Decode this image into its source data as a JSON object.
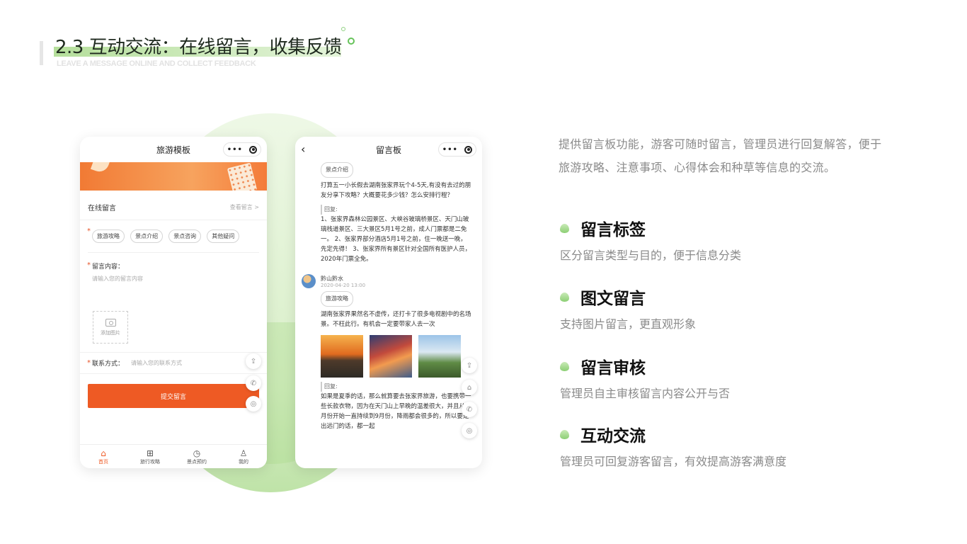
{
  "header": {
    "title": "2.3 互动交流：在线留言，收集反馈",
    "subtitle": "LEAVE A MESSAGE ONLINE AND COLLECT FEEDBACK"
  },
  "colors": {
    "accent_green": "#8ccf74",
    "accent_orange": "#ee5a24"
  },
  "phone1": {
    "nav_title": "旅游模板",
    "section_title": "在线留言",
    "view_link": "查看留言 >",
    "tags": [
      "旅游攻略",
      "景点介绍",
      "景点咨询",
      "其他疑问"
    ],
    "content_label": "留言内容：",
    "content_placeholder": "请输入您的留言内容",
    "upload_label": "添加图片",
    "contact_label": "联系方式：",
    "contact_placeholder": "请输入您的联系方式",
    "submit_label": "提交留言",
    "tabs": [
      {
        "label": "首页",
        "icon": "home-icon"
      },
      {
        "label": "旅行攻略",
        "icon": "grid-icon"
      },
      {
        "label": "景点预约",
        "icon": "clock-icon"
      },
      {
        "label": "我的",
        "icon": "user-icon"
      }
    ]
  },
  "phone2": {
    "nav_title": "留言板",
    "msg1": {
      "tag": "景点介绍",
      "text": "打算五一小长假去湖南张家界玩个4-5天,有没有去过的朋友分享下攻略？大概要花多少钱？怎么安排行程？",
      "reply_label": "回复:",
      "reply": "1、张家界森林公园景区、大峡谷玻璃桥景区、天门山玻璃栈道景区、三大景区5月1号之前，成人门票都是二免一。 2、张家界部分酒店5月1号之前，住一晚送一晚，先定先得！ 3、张家界所有景区针对全国所有医护人员，2020年门票全免。"
    },
    "msg2": {
      "author": "黔山黔水",
      "time": "2020-04-20 13:00",
      "tag": "旅游攻略",
      "text": "湖南张家界果然名不虚传，还打卡了很多电视剧中的名场景。不枉此行。有机会一定要带家人去一次",
      "reply_label": "回复:",
      "reply": "如果是夏季的话，那么就算要去张家界旅游，也要携带一些长款衣物，因为在天门山上早晚的温差很大，并且从4月份开始一直持续到9月份，降雨都会很多的，所以要是出远门的话，都一起"
    }
  },
  "intro": "提供留言板功能，游客可随时留言，管理员进行回复解答，便于旅游攻略、注意事项、心得体会和种草等信息的交流。",
  "features": [
    {
      "title": "留言标签",
      "desc": "区分留言类型与目的，便于信息分类"
    },
    {
      "title": "图文留言",
      "desc": "支持图片留言，更直观形象"
    },
    {
      "title": "留言审核",
      "desc": "管理员自主审核留言内容公开与否"
    },
    {
      "title": "互动交流",
      "desc": "管理员可回复游客留言，有效提高游客满意度"
    }
  ]
}
